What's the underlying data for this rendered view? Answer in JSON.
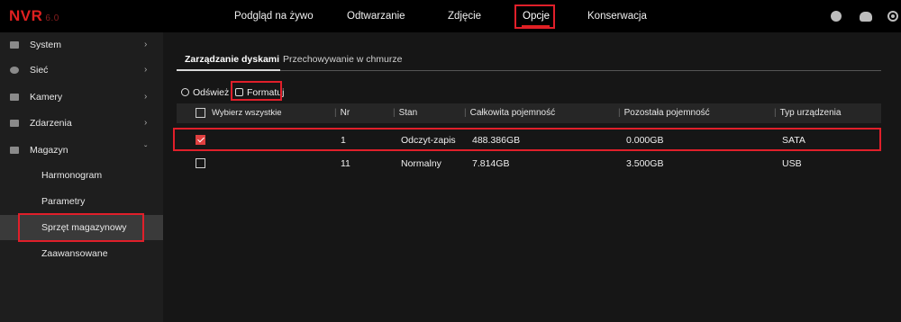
{
  "header": {
    "logo": "NVR",
    "version": "6.0",
    "nav": [
      "Podgląd na żywo",
      "Odtwarzanie",
      "Zdjęcie",
      "Opcje",
      "Konserwacja"
    ],
    "active_nav": "Opcje",
    "icons": [
      "user-icon",
      "cloud-icon",
      "settings-icon"
    ]
  },
  "sidebar": {
    "items": [
      {
        "label": "System",
        "icon": "system-icon"
      },
      {
        "label": "Sieć",
        "icon": "network-icon"
      },
      {
        "label": "Kamery",
        "icon": "camera-icon"
      },
      {
        "label": "Zdarzenia",
        "icon": "events-icon"
      },
      {
        "label": "Magazyn",
        "icon": "storage-icon"
      }
    ],
    "subitems": [
      "Harmonogram",
      "Parametry",
      "Sprzęt magazynowy",
      "Zaawansowane"
    ],
    "active_subitem": "Sprzęt magazynowy"
  },
  "tabs": [
    "Zarządzanie dyskami",
    "Przechowywanie w chmurze"
  ],
  "toolbar": {
    "refresh": "Odśwież",
    "format": "Formatuj"
  },
  "table": {
    "columns": [
      "Wybierz wszystkie",
      "Nr",
      "Stan",
      "Całkowita pojemność",
      "Pozostała pojemność",
      "Typ urządzenia"
    ],
    "rows": [
      {
        "checked": true,
        "nr": "1",
        "stan": "Odczyt-zapis",
        "total": "488.386GB",
        "remaining": "0.000GB",
        "type": "SATA"
      },
      {
        "checked": false,
        "nr": "11",
        "stan": "Normalny",
        "total": "7.814GB",
        "remaining": "3.500GB",
        "type": "USB"
      }
    ]
  },
  "colors": {
    "accent": "#e02020",
    "highlight": "#e01f2a",
    "topbar": "#000000",
    "background": "#161616"
  }
}
